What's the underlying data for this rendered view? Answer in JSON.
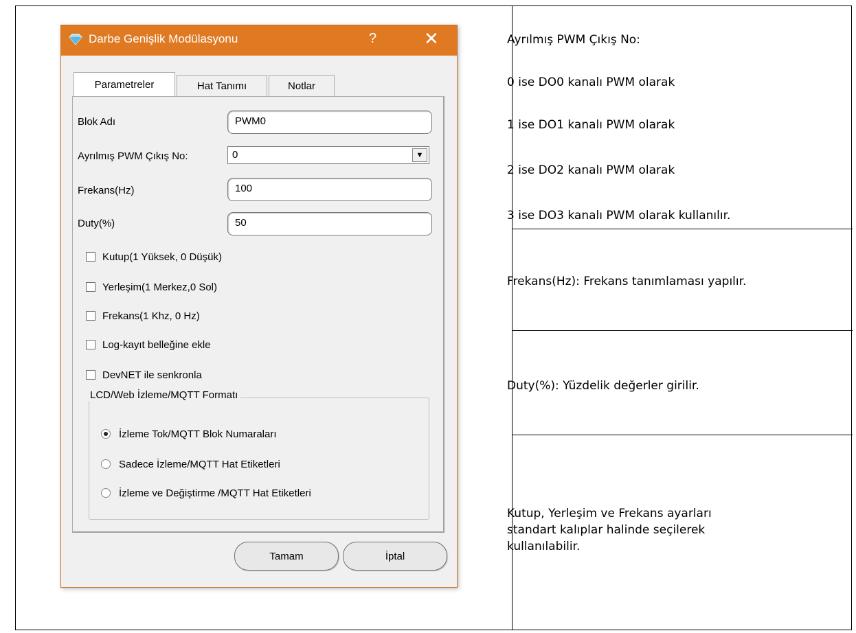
{
  "dialog": {
    "title": "Darbe Genişlik Modülasyonu",
    "help_label": "?",
    "close_label": "✕",
    "tabs": [
      {
        "label": "Parametreler"
      },
      {
        "label": "Hat Tanımı"
      },
      {
        "label": "Notlar"
      }
    ],
    "fields": {
      "block_name": {
        "label": "Blok Adı",
        "value": "PWM0"
      },
      "pwm_output": {
        "label": "Ayrılmış PWM Çıkış No:",
        "value": "0"
      },
      "frequency": {
        "label": "Frekans(Hz)",
        "value": "100"
      },
      "duty": {
        "label": "Duty(%)",
        "value": "50"
      }
    },
    "checkboxes": [
      {
        "label": "Kutup(1 Yüksek, 0 Düşük)",
        "checked": false
      },
      {
        "label": "Yerleşim(1 Merkez,0 Sol)",
        "checked": false
      },
      {
        "label": "Frekans(1 Khz, 0 Hz)",
        "checked": false
      },
      {
        "label": "Log-kayıt belleğine ekle",
        "checked": false
      },
      {
        "label": "DevNET ile senkronla",
        "checked": false
      }
    ],
    "group": {
      "title": "LCD/Web İzleme/MQTT Formatı",
      "options": [
        {
          "label": "İzleme Tok/MQTT Blok Numaraları",
          "selected": true
        },
        {
          "label": "Sadece İzleme/MQTT Hat Etiketleri",
          "selected": false
        },
        {
          "label": "İzleme ve Değiştirme /MQTT Hat Etiketleri",
          "selected": false
        }
      ]
    },
    "buttons": {
      "ok": "Tamam",
      "cancel": "İptal"
    }
  },
  "notes": {
    "pwm": {
      "title": "Ayrılmış PWM Çıkış No:",
      "lines": [
        "0 ise DO0 kanalı PWM olarak",
        "1 ise DO1 kanalı PWM olarak",
        "2 ise DO2 kanalı PWM olarak",
        "3 ise DO3 kanalı PWM olarak kullanılır."
      ]
    },
    "frequency": "Frekans(Hz):  Frekans tanımlaması yapılır.",
    "duty": "Duty(%):  Yüzdelik değerler girilir.",
    "options": [
      "Kutup, Yerleşim ve Frekans ayarları",
      "standart kalıplar halinde seçilerek",
      "kullanılabilir."
    ]
  },
  "colors": {
    "titlebar": "#e07a22",
    "dialog_bg": "#f0f0f0"
  }
}
